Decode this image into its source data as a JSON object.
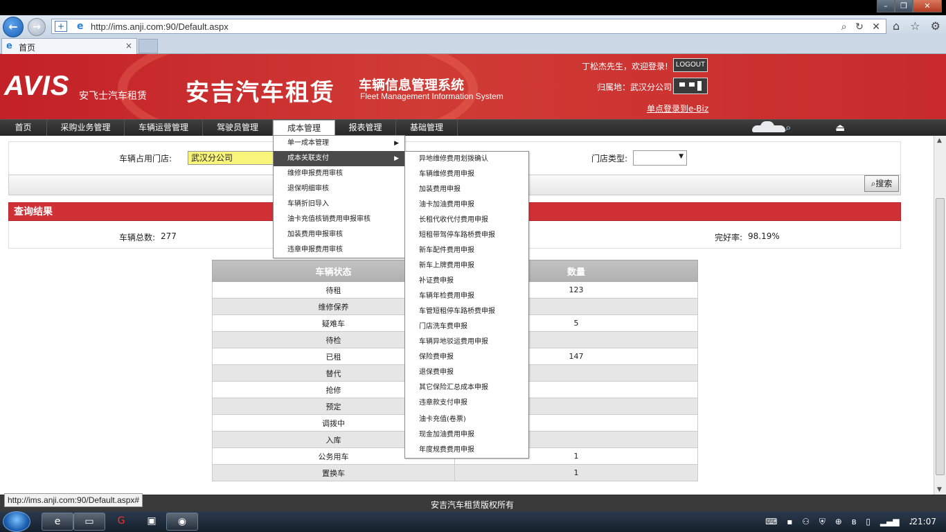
{
  "browser": {
    "url": "http://ims.anji.com:90/Default.aspx",
    "tab_title": "首页",
    "tab_close": "×",
    "status_url": "http://ims.anji.com:90/Default.aspx#"
  },
  "header": {
    "logo": "AVIS",
    "logo_sub": "安飞士汽车租赁",
    "brand_main": "安吉汽车租赁",
    "brand_system": "车辆信息管理系统",
    "brand_system_en": "Fleet Management Information System",
    "welcome": "丁松杰先生，欢迎登录!",
    "logout_label": "LOGOUT",
    "belong": "归属地：武汉分公司",
    "ebiz_link": "单点登录到e-Biz"
  },
  "nav": {
    "items": [
      "首页",
      "采购业务管理",
      "车辆运营管理",
      "驾驶员管理",
      "成本管理",
      "报表管理",
      "基础管理"
    ],
    "active": "成本管理"
  },
  "filter": {
    "store_label": "车辆占用门店:",
    "store_value": "武汉分公司",
    "store_type_label": "门店类型:",
    "store_type_value": "",
    "search_label": "搜索"
  },
  "results": {
    "header": "查询结果",
    "total_label": "车辆总数:",
    "total_value": "277",
    "rate_label": "完好率:",
    "rate_value": "98.19%"
  },
  "table": {
    "columns": [
      "车辆状态",
      "数量"
    ],
    "rows": [
      [
        "待租",
        "123"
      ],
      [
        "维修保养",
        ""
      ],
      [
        "疑难车",
        "5"
      ],
      [
        "待检",
        ""
      ],
      [
        "已租",
        "147"
      ],
      [
        "替代",
        ""
      ],
      [
        "抢修",
        ""
      ],
      [
        "预定",
        ""
      ],
      [
        "调拨中",
        ""
      ],
      [
        "入库",
        ""
      ],
      [
        "公务用车",
        "1"
      ],
      [
        "置换车",
        "1"
      ]
    ]
  },
  "menus": {
    "cost_menu": [
      "单一成本管理",
      "成本关联支付",
      "维修申报费用审核",
      "退保明细审核",
      "车辆折旧导入",
      "油卡充值核销费用申报审核",
      "加装费用申报审核",
      "违章申报费用审核"
    ],
    "cost_menu_highlight": "成本关联支付",
    "sub_menu": [
      "异地维修费用划拨确认",
      "车辆维修费用申报",
      "加装费用申报",
      "油卡加油费用申报",
      "长租代收代付费用申报",
      "短租带驾停车路桥费申报",
      "新车配件费用申报",
      "新车上牌费用申报",
      "补证费申报",
      "车辆年检费用申报",
      "车管短租停车路桥费申报",
      "门店洗车费申报",
      "车辆异地驳运费用申报",
      "保险费申报",
      "退保费申报",
      "其它保险汇总成本申报",
      "违章款支付申报",
      "油卡充值(卷票)",
      "现金加油费用申报",
      "年度规费费用申报"
    ]
  },
  "footer": {
    "copyright": "安吉汽车租赁版权所有"
  },
  "taskbar": {
    "clock": "21:07"
  }
}
